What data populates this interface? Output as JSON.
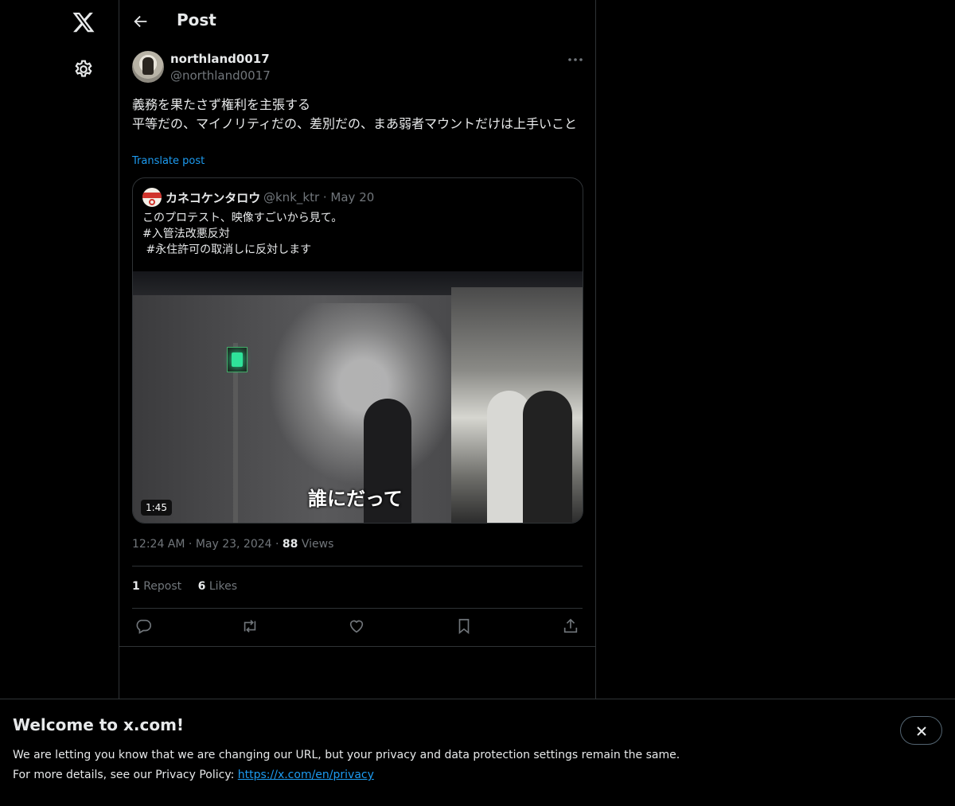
{
  "header": {
    "title": "Post"
  },
  "post": {
    "display_name": "northland0017",
    "handle": "@northland0017",
    "text": "義務を果たさず権利を主張する\n平等だの、マイノリティだの、差別だの、まあ弱者マウントだけは上手いこと",
    "translate_label": "Translate post",
    "time": "12:24 AM",
    "date": "May 23, 2024",
    "views_count": "88",
    "views_label": "Views",
    "reposts_count": "1",
    "reposts_label": "Repost",
    "likes_count": "6",
    "likes_label": "Likes"
  },
  "quote": {
    "display_name": "カネコケンタロウ",
    "handle_date": "@knk_ktr · May 20",
    "text": "このプロテスト、映像すごいから見て。\n#入管法改悪反対\n #永住許可の取消しに反対します",
    "video_subtitle": "誰にだって",
    "video_duration": "1:45"
  },
  "banner": {
    "title": "Welcome to x.com!",
    "line1": "We are letting you know that we are changing our URL, but your privacy and data protection settings remain the same.",
    "line2_prefix": "For more details, see our Privacy Policy: ",
    "link": "https://x.com/en/privacy"
  },
  "icons": {
    "logo": "x-logo-icon",
    "settings": "gear-icon",
    "back": "back-arrow-icon",
    "more": "more-icon",
    "reply": "reply-icon",
    "repost": "repost-icon",
    "like": "heart-icon",
    "bookmark": "bookmark-icon",
    "share": "share-icon",
    "close": "close-icon"
  },
  "colors": {
    "accent": "#1d9bf0",
    "background": "#000000",
    "secondary_text": "#71767b",
    "border": "#2f3336"
  }
}
